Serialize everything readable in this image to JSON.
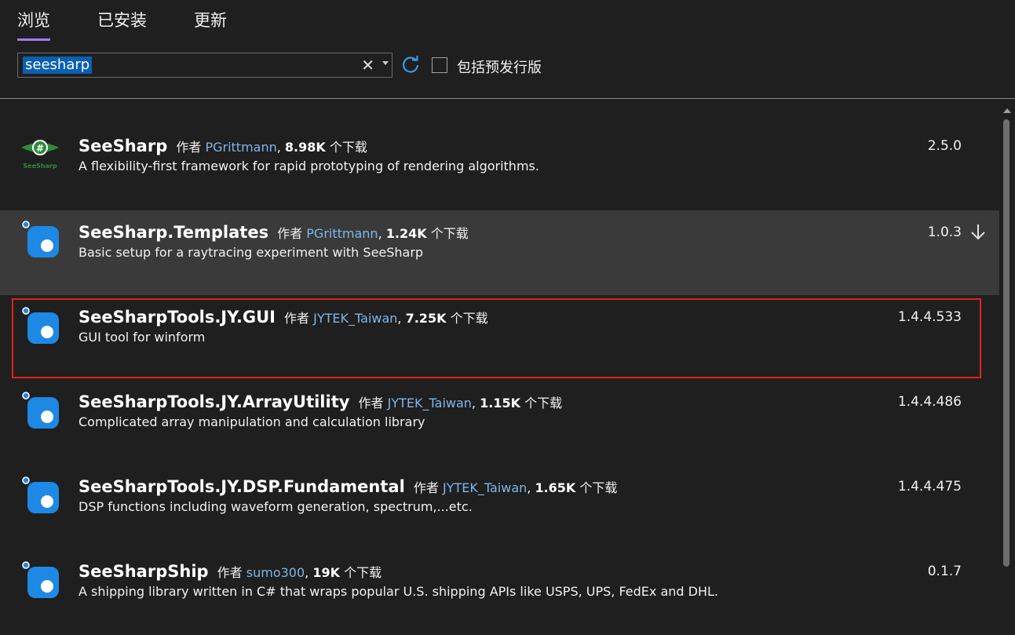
{
  "tabs": [
    {
      "label": "浏览",
      "active": true
    },
    {
      "label": "已安装",
      "active": false
    },
    {
      "label": "更新",
      "active": false
    }
  ],
  "search": {
    "value": "seesharp",
    "clear_icon": "close-icon",
    "dropdown_icon": "chevron-down-icon"
  },
  "refresh_icon": "refresh-icon",
  "prerelease": {
    "label": "包括预发行版",
    "checked": false
  },
  "author_prefix": "作者",
  "downloads_suffix": "个下载",
  "packages": [
    {
      "name": "SeeSharp",
      "author": "PGrittmann",
      "downloads": "8.98K",
      "description": "A flexibility-first framework for rapid prototyping of rendering algorithms.",
      "version": "2.5.0",
      "icon": "seesharp-logo",
      "selected": false
    },
    {
      "name": "SeeSharp.Templates",
      "author": "PGrittmann",
      "downloads": "1.24K",
      "description": "Basic setup for a raytracing experiment with SeeSharp",
      "version": "1.0.3",
      "icon": "package-icon",
      "selected": true,
      "download_icon": "download-icon"
    },
    {
      "name": "SeeSharpTools.JY.GUI",
      "author": "JYTEK_Taiwan",
      "downloads": "7.25K",
      "description": "GUI tool for winform",
      "version": "1.4.4.533",
      "icon": "package-icon",
      "selected": false,
      "highlighted": true
    },
    {
      "name": "SeeSharpTools.JY.ArrayUtility",
      "author": "JYTEK_Taiwan",
      "downloads": "1.15K",
      "description": "Complicated array manipulation and calculation library",
      "version": "1.4.4.486",
      "icon": "package-icon",
      "selected": false
    },
    {
      "name": "SeeSharpTools.JY.DSP.Fundamental",
      "author": "JYTEK_Taiwan",
      "downloads": "1.65K",
      "description": "DSP functions including waveform generation, spectrum,...etc.",
      "version": "1.4.4.475",
      "icon": "package-icon",
      "selected": false
    },
    {
      "name": "SeeSharpShip",
      "author": "sumo300",
      "downloads": "19K",
      "description": "A shipping library written in C# that wraps popular U.S. shipping APIs like USPS, UPS, FedEx and DHL.",
      "version": "0.1.7",
      "icon": "package-icon",
      "selected": false
    }
  ],
  "colors": {
    "accent": "#9d7cf0",
    "link": "#7eb6e8",
    "selection": "#3a3a3a",
    "highlight_border": "#e02020",
    "icon_blue": "#1e88e5"
  }
}
